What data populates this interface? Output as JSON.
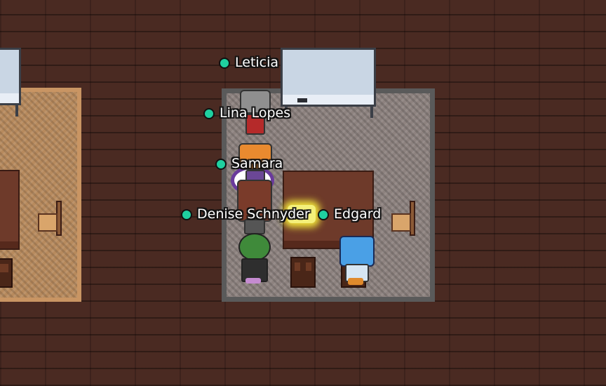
{
  "status_color": "#1fd0a0",
  "players": [
    {
      "name": "Leticia"
    },
    {
      "name": "Lina Lopes"
    },
    {
      "name": "Samara"
    },
    {
      "name": "Denise Schnyder"
    },
    {
      "name": "Edgard"
    }
  ],
  "colors": {
    "floor": "#4a2a22",
    "rug_main": "#8d827f",
    "rug_left": "#b78a5d",
    "table": "#6e3a2a",
    "highlight": "#f4f07a",
    "interaction_ring": "#6a3a9c"
  }
}
